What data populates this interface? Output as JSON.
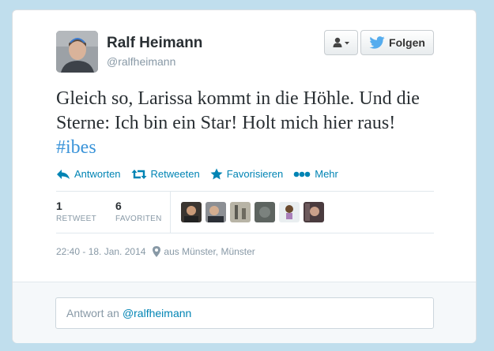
{
  "profile": {
    "name": "Ralf Heimann",
    "handle": "@ralfheimann"
  },
  "buttons": {
    "follow_label": "Folgen",
    "user_menu_icon": "person-dropdown-icon"
  },
  "tweet": {
    "text_before": "Gleich so, Larissa kommt in die Höhle. Und die Sterne: Ich bin ein Star! Holt mich hier raus! ",
    "hashtag": "#ibes"
  },
  "actions": [
    {
      "label": "Antworten",
      "icon": "reply-icon"
    },
    {
      "label": "Retweeten",
      "icon": "retweet-icon"
    },
    {
      "label": "Favorisieren",
      "icon": "star-icon"
    },
    {
      "label": "Mehr",
      "icon": "more-dots-icon"
    }
  ],
  "stats": {
    "retweets": {
      "count": "1",
      "label": "RETWEET"
    },
    "favorites": {
      "count": "6",
      "label": "FAVORITEN"
    }
  },
  "meta": {
    "datetime": "22:40 - 18. Jan. 2014",
    "location": "aus Münster, Münster"
  },
  "reply": {
    "prefix": "Antwort an",
    "mention": "@ralfheimann"
  },
  "colors": {
    "background": "#c0deed",
    "link": "#0084b4",
    "hashtag": "#3b94d9",
    "twitter_blue": "#55acee"
  }
}
